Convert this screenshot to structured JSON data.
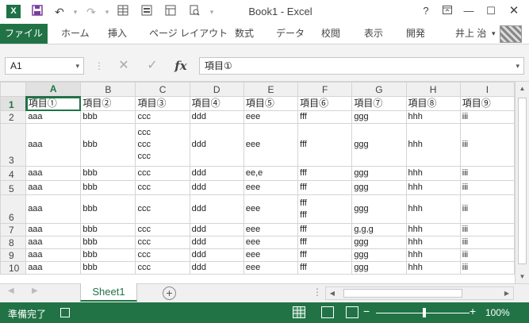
{
  "titlebar": {
    "app_icon": "X",
    "title": "Book1 - Excel",
    "help": "?",
    "icons": [
      "excel-app-icon",
      "save-icon",
      "undo-icon",
      "redo-icon",
      "table-icon",
      "form-icon",
      "data-form-icon",
      "print-preview-icon",
      "help-icon",
      "ribbon-display-icon",
      "minimize-icon",
      "maximize-icon",
      "close-icon"
    ]
  },
  "ribbon": {
    "file_tab": "ファイル",
    "tabs": [
      "ホーム",
      "挿入",
      "ページ レイアウト",
      "数式",
      "データ",
      "校閲",
      "表示",
      "開発"
    ],
    "user_name": "井上 治"
  },
  "formula_bar": {
    "name_box": "A1",
    "fx": "fx",
    "content": "項目①"
  },
  "sheet": {
    "columns": [
      "A",
      "B",
      "C",
      "D",
      "E",
      "F",
      "G",
      "H",
      "I"
    ],
    "active_column": "A",
    "active_row": "1",
    "rows": [
      {
        "num": "1",
        "cells": [
          [
            "項目①"
          ],
          [
            "項目②"
          ],
          [
            "項目③"
          ],
          [
            "項目④"
          ],
          [
            "項目⑤"
          ],
          [
            "項目⑥"
          ],
          [
            "項目⑦"
          ],
          [
            "項目⑧"
          ],
          [
            "項目⑨"
          ]
        ]
      },
      {
        "num": "2",
        "cells": [
          [
            "aaa"
          ],
          [
            "bbb"
          ],
          [
            "ccc"
          ],
          [
            "ddd"
          ],
          [
            "eee"
          ],
          [
            "fff"
          ],
          [
            "ggg"
          ],
          [
            "hhh"
          ],
          [
            "iii"
          ]
        ]
      },
      {
        "num": "3",
        "cells": [
          [
            "aaa"
          ],
          [
            "bbb"
          ],
          [
            "ccc",
            "ccc",
            "ccc"
          ],
          [
            "ddd"
          ],
          [
            "eee"
          ],
          [
            "fff"
          ],
          [
            "ggg"
          ],
          [
            "hhh"
          ],
          [
            "iii"
          ]
        ]
      },
      {
        "num": "4",
        "cells": [
          [
            "aaa"
          ],
          [
            "bbb"
          ],
          [
            "ccc"
          ],
          [
            "ddd"
          ],
          [
            "ee,e"
          ],
          [
            "fff"
          ],
          [
            "ggg"
          ],
          [
            "hhh"
          ],
          [
            "iii"
          ]
        ]
      },
      {
        "num": "5",
        "cells": [
          [
            "aaa"
          ],
          [
            "bbb"
          ],
          [
            "ccc"
          ],
          [
            "ddd"
          ],
          [
            "eee"
          ],
          [
            "fff"
          ],
          [
            "ggg"
          ],
          [
            "hhh"
          ],
          [
            "iii"
          ]
        ]
      },
      {
        "num": "6",
        "cells": [
          [
            "aaa"
          ],
          [
            "bbb"
          ],
          [
            "ccc"
          ],
          [
            "ddd"
          ],
          [
            "eee"
          ],
          [
            "fff",
            "fff"
          ],
          [
            "ggg"
          ],
          [
            "hhh"
          ],
          [
            "iii"
          ]
        ]
      },
      {
        "num": "7",
        "cells": [
          [
            "aaa"
          ],
          [
            "bbb"
          ],
          [
            "ccc"
          ],
          [
            "ddd"
          ],
          [
            "eee"
          ],
          [
            "fff"
          ],
          [
            "g,g,g"
          ],
          [
            "hhh"
          ],
          [
            "iii"
          ]
        ]
      },
      {
        "num": "8",
        "cells": [
          [
            "aaa"
          ],
          [
            "bbb"
          ],
          [
            "ccc"
          ],
          [
            "ddd"
          ],
          [
            "eee"
          ],
          [
            "fff"
          ],
          [
            "ggg"
          ],
          [
            "hhh"
          ],
          [
            "iii"
          ]
        ]
      },
      {
        "num": "9",
        "cells": [
          [
            "aaa"
          ],
          [
            "bbb"
          ],
          [
            "ccc"
          ],
          [
            "ddd"
          ],
          [
            "eee"
          ],
          [
            "fff"
          ],
          [
            "ggg"
          ],
          [
            "hhh"
          ],
          [
            "iii"
          ]
        ]
      },
      {
        "num": "10",
        "cells": [
          [
            "aaa"
          ],
          [
            "bbb"
          ],
          [
            "ccc"
          ],
          [
            "ddd"
          ],
          [
            "eee"
          ],
          [
            "fff"
          ],
          [
            "ggg"
          ],
          [
            "hhh"
          ],
          [
            "iii"
          ]
        ]
      }
    ]
  },
  "sheet_tabs": {
    "tabs": [
      "Sheet1"
    ],
    "add": "+",
    "more": "..."
  },
  "statusbar": {
    "status": "準備完了",
    "zoom": "100%",
    "zoom_minus": "−",
    "zoom_plus": "+"
  },
  "colors": {
    "accent": "#217346",
    "grid": "#d4d4d4",
    "header_bg": "#f0f0f0"
  }
}
